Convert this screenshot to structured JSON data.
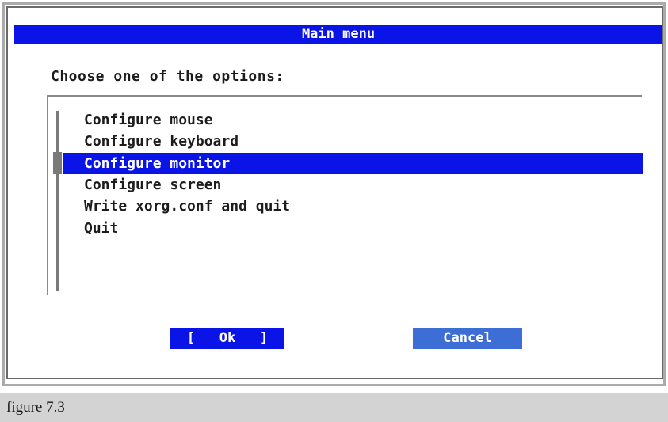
{
  "dialog": {
    "title": "Main menu",
    "prompt": "Choose one of the options:",
    "items": [
      {
        "label": "Configure mouse",
        "selected": false
      },
      {
        "label": "Configure keyboard",
        "selected": false
      },
      {
        "label": "Configure monitor",
        "selected": true
      },
      {
        "label": "Configure screen",
        "selected": false
      },
      {
        "label": "Write xorg.conf and quit",
        "selected": false
      },
      {
        "label": "Quit",
        "selected": false
      }
    ],
    "buttons": {
      "ok": "[   Ok   ]",
      "cancel": "Cancel"
    }
  },
  "caption": "figure 7.3",
  "colors": {
    "accent": "#0a14e6",
    "cancel_bg": "#3c6ed6",
    "caption_bg": "#d3d3d3"
  }
}
